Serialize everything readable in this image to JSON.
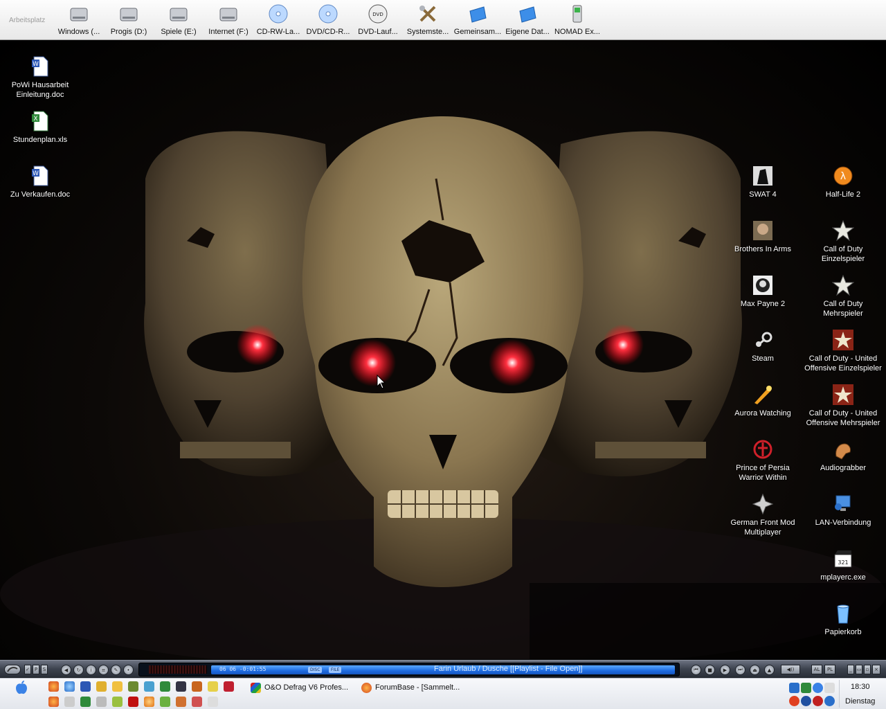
{
  "topbar": {
    "title": "Arbeitsplatz",
    "drives": [
      {
        "label": "Windows (...",
        "icon": "hard-drive-icon"
      },
      {
        "label": "Progis (D:)",
        "icon": "hard-drive-icon"
      },
      {
        "label": "Spiele (E:)",
        "icon": "hard-drive-icon"
      },
      {
        "label": "Internet (F:)",
        "icon": "hard-drive-icon"
      },
      {
        "label": "CD-RW-La...",
        "icon": "cd-drive-icon"
      },
      {
        "label": "DVD/CD-R...",
        "icon": "cd-drive-icon"
      },
      {
        "label": "DVD-Lauf...",
        "icon": "dvd-drive-icon"
      },
      {
        "label": "Systemste...",
        "icon": "control-panel-icon"
      },
      {
        "label": "Gemeinsam...",
        "icon": "shared-folder-icon"
      },
      {
        "label": "Eigene Dat...",
        "icon": "my-documents-icon"
      },
      {
        "label": "NOMAD Ex...",
        "icon": "mp3-player-icon"
      }
    ]
  },
  "desktop": {
    "left_icons": [
      {
        "label": "PoWi Hausarbeit\nEinleitung.doc",
        "icon": "word-document-icon"
      },
      {
        "label": "Stundenplan.xls",
        "icon": "excel-document-icon"
      },
      {
        "label": "Zu Verkaufen.doc",
        "icon": "word-document-icon"
      }
    ],
    "right_col1": [
      {
        "label": "SWAT 4",
        "icon": "swat4-icon"
      },
      {
        "label": "Brothers In Arms",
        "icon": "brothers-in-arms-icon"
      },
      {
        "label": "Max Payne 2",
        "icon": "max-payne-icon"
      },
      {
        "label": "Steam",
        "icon": "steam-icon"
      },
      {
        "label": "Aurora Watching",
        "icon": "aurora-watching-icon"
      },
      {
        "label": "Prince of Persia\nWarrior Within",
        "icon": "prince-of-persia-icon"
      },
      {
        "label": "German Front Mod\nMultiplayer",
        "icon": "german-front-mod-icon"
      }
    ],
    "right_col2": [
      {
        "label": "Half-Life 2",
        "icon": "half-life-icon"
      },
      {
        "label": "Call of Duty\nEinzelspieler",
        "icon": "call-of-duty-icon"
      },
      {
        "label": "Call of Duty\nMehrspieler",
        "icon": "call-of-duty-icon"
      },
      {
        "label": "Call of Duty - United\nOffensive Einzelspieler",
        "icon": "call-of-duty-uo-icon"
      },
      {
        "label": "Call of Duty - United\nOffensive Mehrspieler",
        "icon": "call-of-duty-uo-icon"
      },
      {
        "label": "Audiograbber",
        "icon": "audiograbber-icon"
      },
      {
        "label": "LAN-Verbindung",
        "icon": "network-connection-icon"
      },
      {
        "label": "mplayerc.exe",
        "icon": "media-player-classic-icon"
      },
      {
        "label": "Papierkorb",
        "icon": "recycle-bin-icon"
      }
    ]
  },
  "winamp": {
    "time": "06 06   -0:01:55",
    "disc_label": "DISC",
    "file_label": "FILE",
    "track_title": "Farin Urlaub / Dusche     [[Playlist - File Open]]",
    "left_buttons": [
      "✓",
      "P",
      "S"
    ],
    "right_buttons": [
      "AL",
      "PL"
    ]
  },
  "taskbar": {
    "tasks": [
      {
        "label": "O&O Defrag V6 Profes...",
        "icon": "defrag-icon"
      },
      {
        "label": "ForumBase - [Sammelt...",
        "icon": "firefox-icon"
      }
    ],
    "clock": "18:30",
    "day": "Dienstag"
  },
  "colors": {
    "accent_blue": "#1e6be0",
    "winamp_dark": "#3d434f",
    "taskbar_bg": "#e8ebf0"
  }
}
